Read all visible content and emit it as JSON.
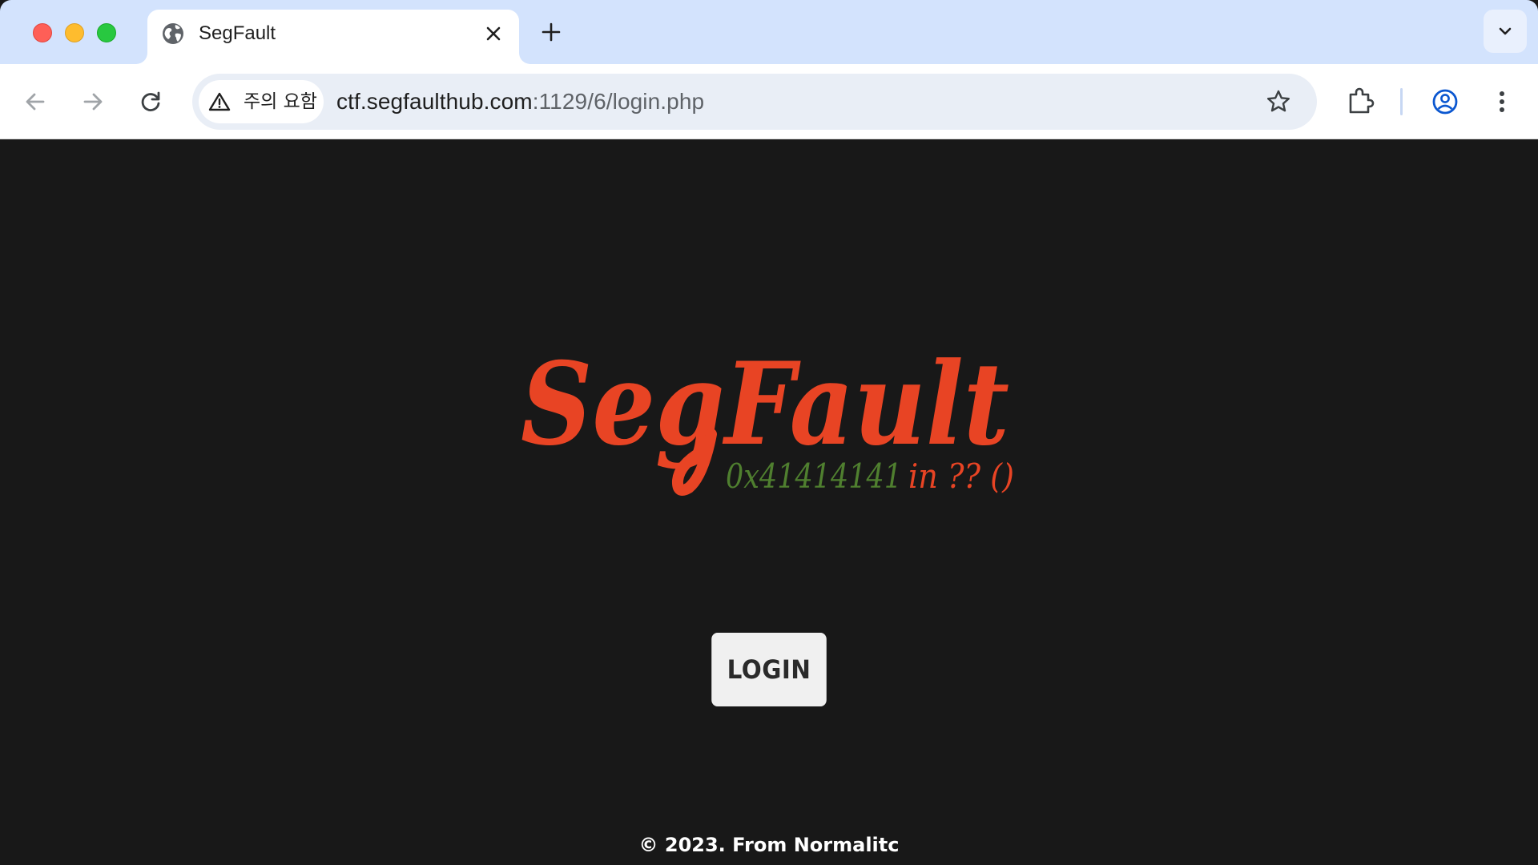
{
  "browser": {
    "tab": {
      "title": "SegFault"
    },
    "omnibox": {
      "security_label": "주의 요함",
      "url_host": "ctf.segfaulthub.com",
      "url_rest": ":1129/6/login.php"
    },
    "icons": {
      "favicon": "globe-icon",
      "tab_close": "close-icon",
      "new_tab": "plus-icon",
      "tab_search": "chevron-down-icon",
      "back": "arrow-left-icon",
      "forward": "arrow-right-icon",
      "reload": "reload-icon",
      "security": "warning-triangle-icon",
      "bookmark": "star-icon",
      "extensions": "puzzle-icon",
      "profile": "account-circle-icon",
      "menu": "more-vert-icon"
    }
  },
  "page": {
    "logo": {
      "title": "SegFault",
      "tagline_address": "0x41414141",
      "tagline_rest": "in ?? ()"
    },
    "login_label": "LOGIN",
    "footer": "© 2023. From Normalitc"
  },
  "colors": {
    "page_background": "#181818",
    "logo_red": "#e84424",
    "tagline_green": "#4f7f2f",
    "button_background": "#f0f0f0",
    "tabstrip": "#d3e3fd"
  }
}
